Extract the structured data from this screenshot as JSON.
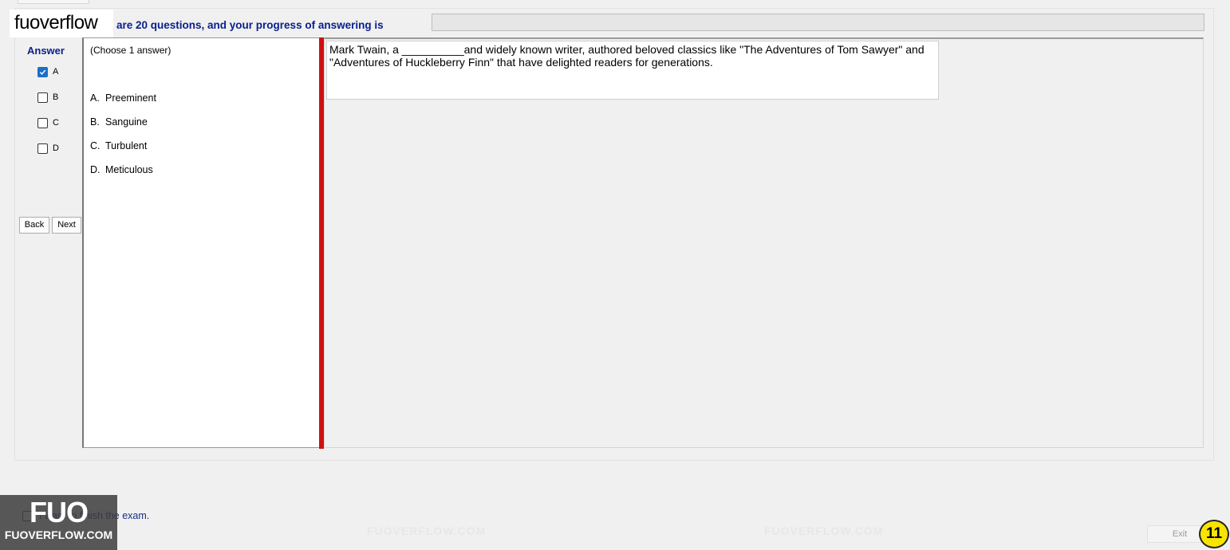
{
  "header": {
    "watermark": "fuoverflow",
    "progress_text": "are 20 questions, and your progress of answering is",
    "progress_fraction": 0
  },
  "answer_panel": {
    "title": "Answer",
    "options": [
      {
        "label": "A",
        "checked": true
      },
      {
        "label": "B",
        "checked": false
      },
      {
        "label": "C",
        "checked": false
      },
      {
        "label": "D",
        "checked": false
      }
    ],
    "back_label": "Back",
    "next_label": "Next"
  },
  "choices": {
    "hint": "(Choose 1 answer)",
    "items": [
      {
        "letter": "A.",
        "text": "Preeminent"
      },
      {
        "letter": "B.",
        "text": "Sanguine"
      },
      {
        "letter": "C.",
        "text": "Turbulent"
      },
      {
        "letter": "D.",
        "text": "Meticulous"
      }
    ]
  },
  "question": {
    "text": "Mark Twain, a __________and widely known writer, authored beloved classics like \"The Adventures of Tom Sawyer\" and \"Adventures of Huckleberry Finn\" that have delighted readers for generations."
  },
  "footer": {
    "finish_label": "I want to finish the exam.",
    "exit_label": "Exit",
    "page_number": "11"
  },
  "brand": {
    "logo": "FUO",
    "site": "FUOVERFLOW.COM"
  },
  "colors": {
    "accent_blue": "#0a1e8c",
    "splitter_red": "#cf1010",
    "badge_yellow": "#f7e400"
  }
}
